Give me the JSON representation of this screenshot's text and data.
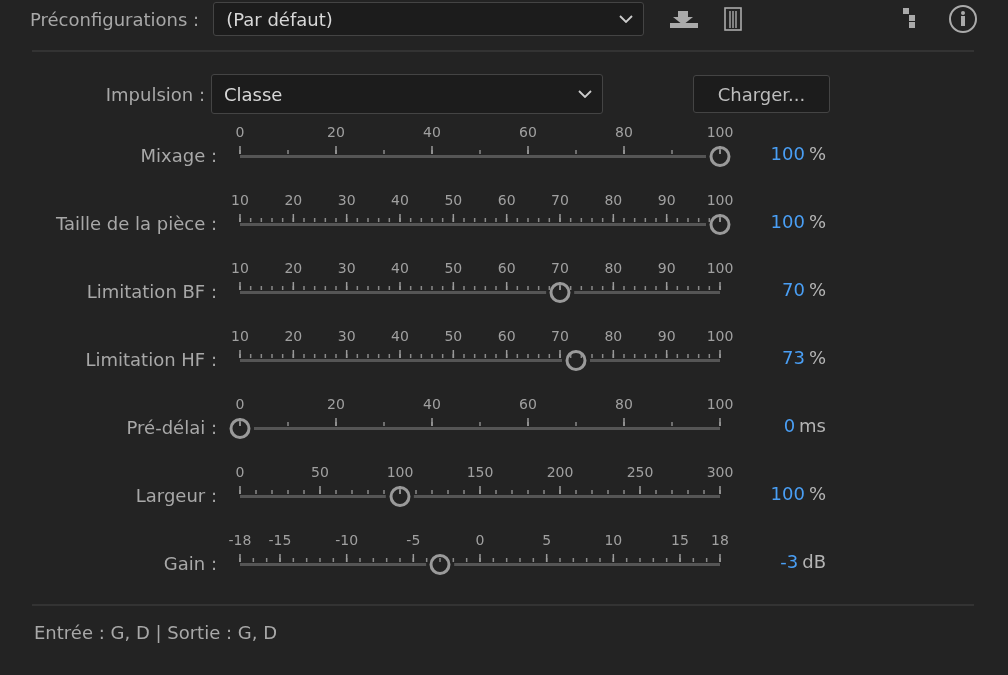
{
  "presets": {
    "label": "Préconfigurations :",
    "value": "(Par défaut)"
  },
  "impulse": {
    "label": "Impulsion :",
    "value": "Classe",
    "button": "Charger..."
  },
  "sliders": [
    {
      "label": "Mixage :",
      "ticks": [
        "0",
        "20",
        "40",
        "60",
        "80",
        "100"
      ],
      "level": 1,
      "value": "100",
      "unit": "%"
    },
    {
      "label": "Taille de la pièce :",
      "ticks": [
        "10",
        "20",
        "30",
        "40",
        "50",
        "60",
        "70",
        "80",
        "90",
        "100"
      ],
      "level": 1,
      "value": "100",
      "unit": "%"
    },
    {
      "label": "Limitation BF :",
      "ticks": [
        "10",
        "20",
        "30",
        "40",
        "50",
        "60",
        "70",
        "80",
        "90",
        "100"
      ],
      "level": 0.667,
      "value": "70",
      "unit": "%"
    },
    {
      "label": "Limitation HF :",
      "ticks": [
        "10",
        "20",
        "30",
        "40",
        "50",
        "60",
        "70",
        "80",
        "90",
        "100"
      ],
      "level": 0.7,
      "value": "73",
      "unit": "%"
    },
    {
      "label": "Pré-délai :",
      "ticks": [
        "0",
        "20",
        "40",
        "60",
        "80",
        "100"
      ],
      "level": 0,
      "value": "0",
      "unit": "ms"
    },
    {
      "label": "Largeur :",
      "ticks": [
        "0",
        "50",
        "100",
        "150",
        "200",
        "250",
        "300"
      ],
      "level": 0.333,
      "value": "100",
      "unit": "%"
    },
    {
      "label": "Gain :",
      "ticks": [
        "-18",
        "-15",
        "-10",
        "-5",
        "0",
        "5",
        "10",
        "15",
        "18"
      ],
      "level": 0.417,
      "value": "-3",
      "unit": "dB"
    }
  ],
  "footer": "Entrée : G, D | Sortie : G, D"
}
